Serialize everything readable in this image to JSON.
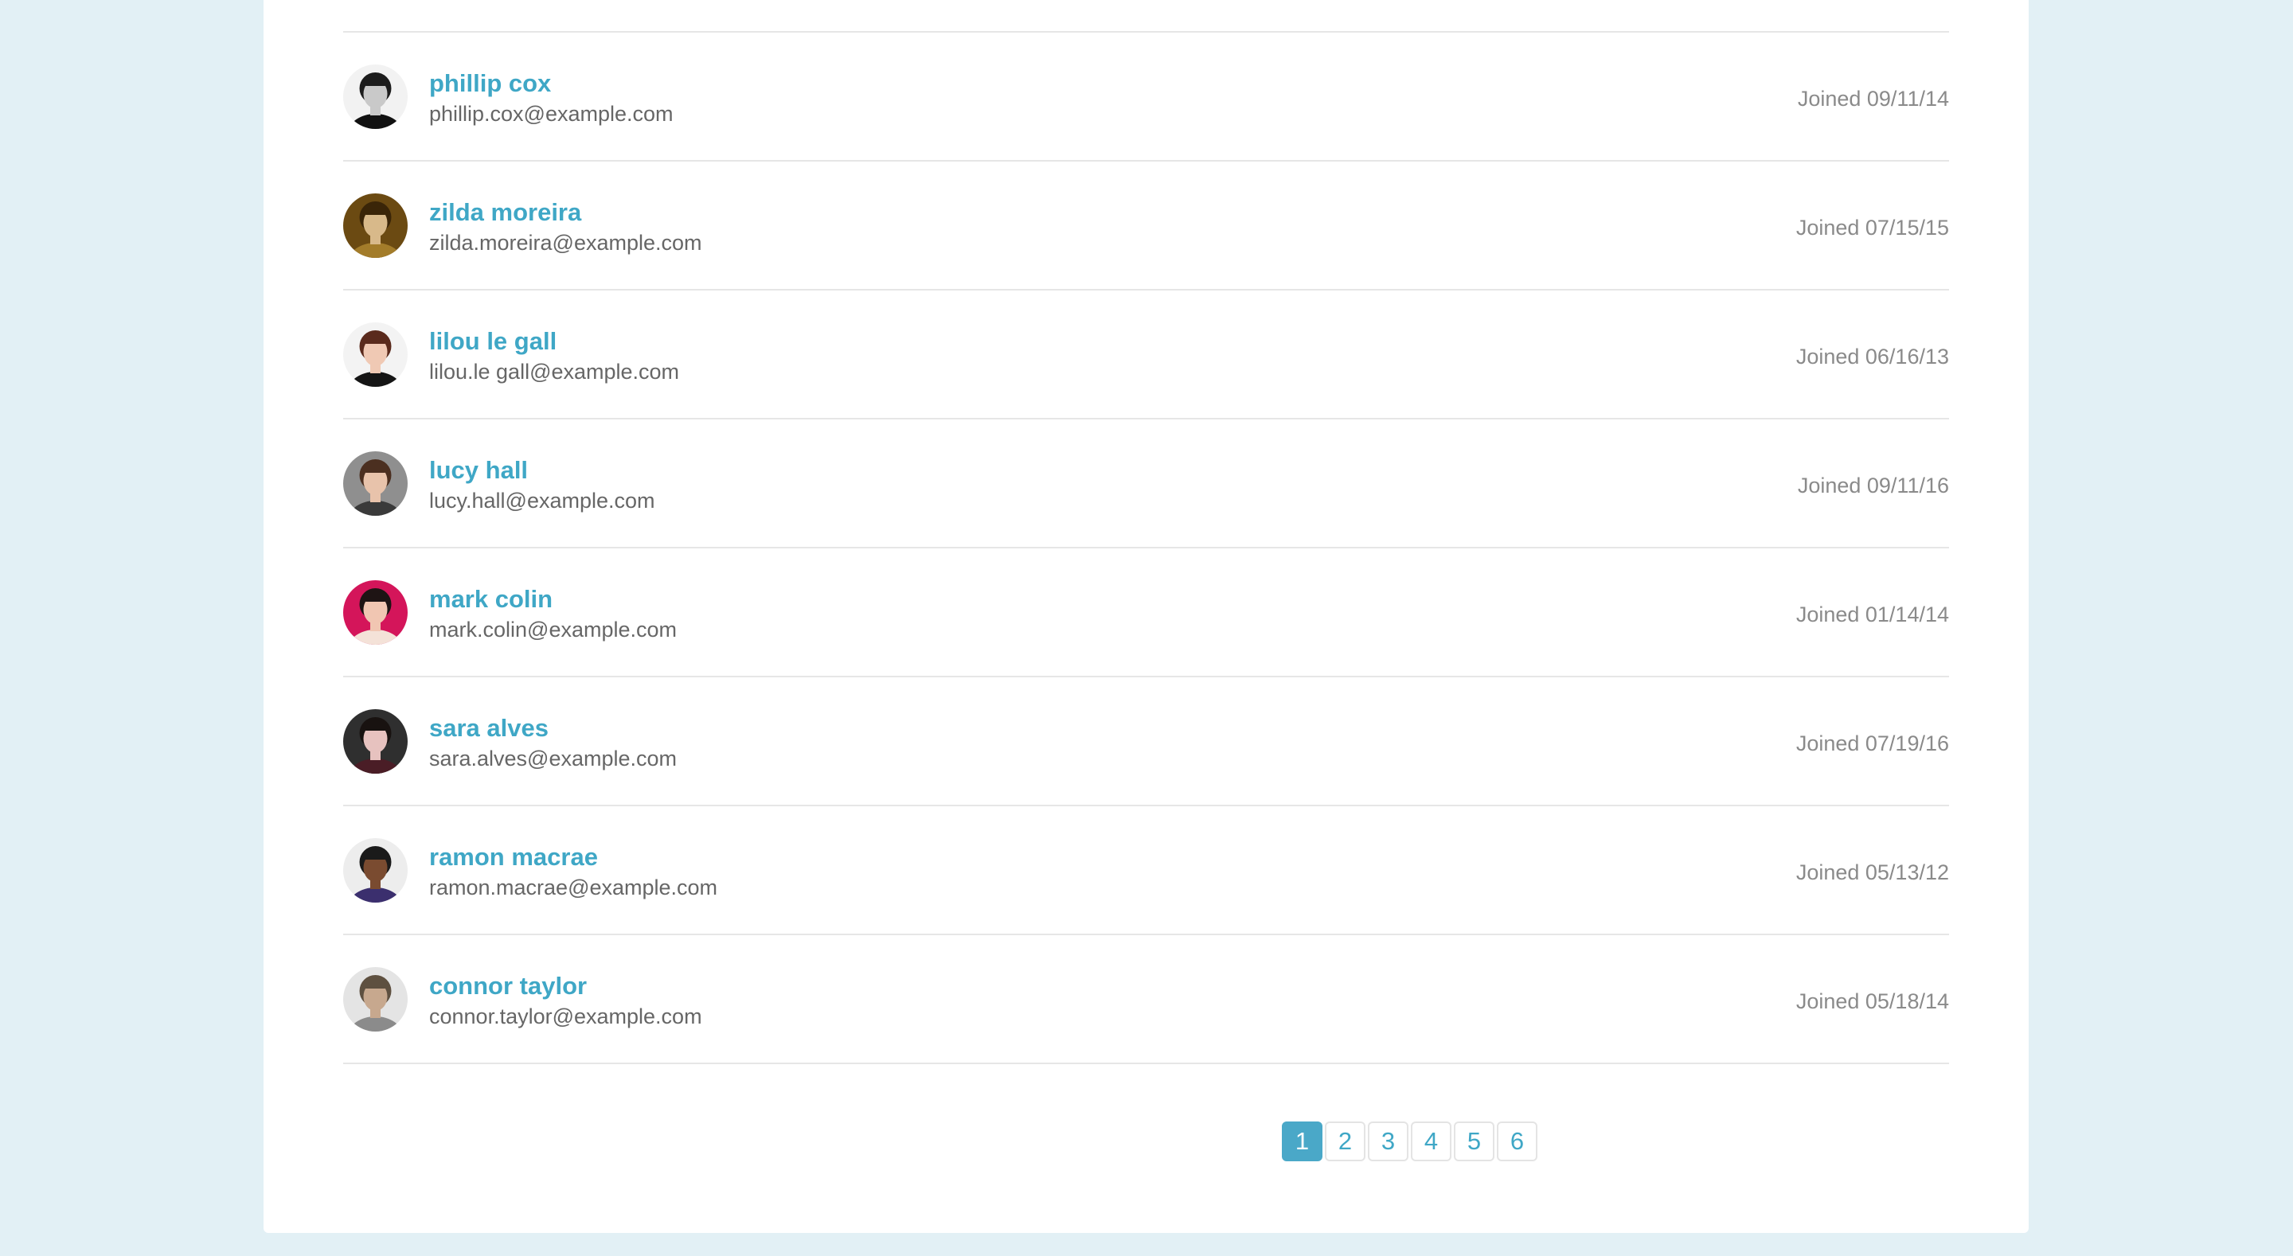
{
  "users": [
    {
      "name": "phillip cox",
      "email": "phillip.cox@example.com",
      "joined": "Joined 09/11/14",
      "avatar": {
        "bg": "#f2f2f2",
        "hair": "#1c1c1c",
        "skin": "#c9c9c9",
        "shirt": "#111111"
      }
    },
    {
      "name": "zilda moreira",
      "email": "zilda.moreira@example.com",
      "joined": "Joined 07/15/15",
      "avatar": {
        "bg": "#6b4a12",
        "hair": "#3a2508",
        "skin": "#d8b98a",
        "shirt": "#a37c2a"
      }
    },
    {
      "name": "lilou le gall",
      "email": "lilou.le gall@example.com",
      "joined": "Joined 06/16/13",
      "avatar": {
        "bg": "#f3f3f3",
        "hair": "#5a2a1c",
        "skin": "#f0c9b4",
        "shirt": "#151515"
      }
    },
    {
      "name": "lucy hall",
      "email": "lucy.hall@example.com",
      "joined": "Joined 09/11/16",
      "avatar": {
        "bg": "#8f8f8f",
        "hair": "#4b2f20",
        "skin": "#e8c3ab",
        "shirt": "#3a3a3a"
      }
    },
    {
      "name": "mark colin",
      "email": "mark.colin@example.com",
      "joined": "Joined 01/14/14",
      "avatar": {
        "bg": "#d4155a",
        "hair": "#1e1414",
        "skin": "#f1c6b2",
        "shirt": "#f4e2d8"
      }
    },
    {
      "name": "sara alves",
      "email": "sara.alves@example.com",
      "joined": "Joined 07/19/16",
      "avatar": {
        "bg": "#2f2f2f",
        "hair": "#181210",
        "skin": "#e7c2bf",
        "shirt": "#4a1d26"
      }
    },
    {
      "name": "ramon macrae",
      "email": "ramon.macrae@example.com",
      "joined": "Joined 05/13/12",
      "avatar": {
        "bg": "#ededed",
        "hair": "#1a1a1a",
        "skin": "#7a4b30",
        "shirt": "#3b2f6e"
      }
    },
    {
      "name": "connor taylor",
      "email": "connor.taylor@example.com",
      "joined": "Joined 05/18/14",
      "avatar": {
        "bg": "#e4e4e4",
        "hair": "#5e5040",
        "skin": "#c7a88e",
        "shirt": "#8b8b8b"
      }
    }
  ],
  "pagination": {
    "pages": [
      "1",
      "2",
      "3",
      "4",
      "5",
      "6"
    ],
    "current": "1"
  },
  "colors": {
    "accent": "#3fa7c6",
    "page_background": "#e2f0f5"
  }
}
